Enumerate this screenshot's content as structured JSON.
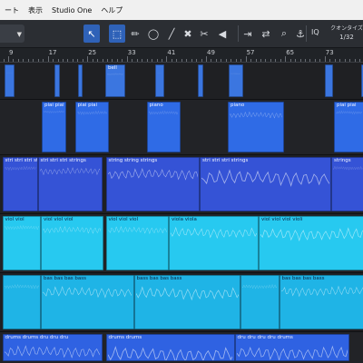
{
  "menu": {
    "items": [
      "ート",
      "表示",
      "Studio One",
      "ヘルプ"
    ]
  },
  "toolbar": {
    "tools": [
      {
        "name": "arrow-tool-icon",
        "glyph": "↖",
        "active": true
      },
      {
        "name": "range-tool-icon",
        "glyph": "⬚",
        "active": true
      },
      {
        "name": "pencil-tool-icon",
        "glyph": "✏",
        "active": false
      },
      {
        "name": "eraser-tool-icon",
        "glyph": "◯",
        "active": false
      },
      {
        "name": "paint-tool-icon",
        "glyph": "╱",
        "active": false
      },
      {
        "name": "mute-tool-icon",
        "glyph": "✖",
        "active": false
      },
      {
        "name": "split-tool-icon",
        "glyph": "✂",
        "active": false
      },
      {
        "name": "listen-tool-icon",
        "glyph": "◀",
        "active": false
      },
      {
        "name": "skip-forward-icon",
        "glyph": "⇥",
        "active": false
      },
      {
        "name": "shuffle-icon",
        "glyph": "⇄",
        "active": false
      },
      {
        "name": "zoom-tool-icon",
        "glyph": "⌕",
        "active": false
      },
      {
        "name": "snap-icon",
        "glyph": "⚓",
        "active": false
      }
    ],
    "iq_label": "IQ",
    "quantize_label": "クオンタイズ",
    "quantize_value": "1/32"
  },
  "ruler": {
    "bars": [
      {
        "label": "9",
        "bar": 9
      },
      {
        "label": "17",
        "bar": 17
      },
      {
        "label": "25",
        "bar": 25
      },
      {
        "label": "33",
        "bar": 33
      },
      {
        "label": "41",
        "bar": 41
      },
      {
        "label": "49",
        "bar": 49
      },
      {
        "label": "57",
        "bar": 57
      },
      {
        "label": "65",
        "bar": 65
      },
      {
        "label": "73",
        "bar": 73
      }
    ]
  },
  "colors": {
    "bell": "#3b76e0",
    "piano": "#2f6be6",
    "strings": "#3553d6",
    "violin": "#27c9f0",
    "bass": "#1fb4e6",
    "drums": "#2f62e2",
    "playhead": "#2f7dff"
  },
  "lanes": [
    {
      "name": "bell",
      "color": "bell",
      "clips": [
        {
          "s": 0.97,
          "e": 3.17,
          "label": ""
        },
        {
          "s": 11.9,
          "e": 13.2,
          "label": ""
        },
        {
          "s": 17.2,
          "e": 18.1,
          "label": ""
        },
        {
          "s": 23.2,
          "e": 27.5,
          "label": "bell"
        },
        {
          "s": 34.1,
          "e": 36.1,
          "label": ""
        },
        {
          "s": 43.5,
          "e": 44.8,
          "label": ""
        },
        {
          "s": 50.3,
          "e": 53.5,
          "label": ""
        },
        {
          "s": 71.6,
          "e": 73.3,
          "label": ""
        },
        {
          "s": 79.5,
          "e": 80.3,
          "label": ""
        }
      ]
    },
    {
      "name": "piano",
      "color": "piano",
      "clips": [
        {
          "s": 9.2,
          "e": 14.5,
          "label": "piai piai piai piai"
        },
        {
          "s": 16.5,
          "e": 24.0,
          "label": "piai piai"
        },
        {
          "s": 32.3,
          "e": 39.7,
          "label": "piano"
        },
        {
          "s": 50.2,
          "e": 62.5,
          "label": "piano"
        },
        {
          "s": 73.6,
          "e": 80.3,
          "label": "piai piai"
        }
      ]
    },
    {
      "name": "strings",
      "color": "strings",
      "clips": [
        {
          "s": 0.5,
          "e": 8.3,
          "label": "stri stri stri strings"
        },
        {
          "s": 8.3,
          "e": 22.5,
          "label": "stri stri stri strings"
        },
        {
          "s": 23.3,
          "e": 44.0,
          "label": "string string strings"
        },
        {
          "s": 44.0,
          "e": 73.0,
          "label": "stri stri stri strings"
        },
        {
          "s": 73.0,
          "e": 80.3,
          "label": "strings"
        }
      ]
    },
    {
      "name": "violin",
      "color": "violin",
      "clips": [
        {
          "s": 0.5,
          "e": 9.0,
          "label": "viol viol"
        },
        {
          "s": 9.0,
          "e": 22.7,
          "label": "viol viol viol"
        },
        {
          "s": 23.3,
          "e": 37.2,
          "label": "viol viol viol"
        },
        {
          "s": 37.2,
          "e": 57.0,
          "label": "viola viola"
        },
        {
          "s": 57.0,
          "e": 80.3,
          "label": "viol viol viol violi"
        }
      ]
    },
    {
      "name": "bass",
      "color": "bass",
      "clips": [
        {
          "s": 0.5,
          "e": 9.0,
          "label": ""
        },
        {
          "s": 9.0,
          "e": 29.5,
          "label": "bas bas bas bass"
        },
        {
          "s": 29.5,
          "e": 53.0,
          "label": "bass bas bas bass"
        },
        {
          "s": 53.0,
          "e": 61.5,
          "label": ""
        },
        {
          "s": 61.5,
          "e": 80.3,
          "label": "bas bas bas bass"
        }
      ]
    },
    {
      "name": "drums",
      "color": "drums",
      "clips": [
        {
          "s": 0.5,
          "e": 22.5,
          "label": "drums drums dru dru dru"
        },
        {
          "s": 23.3,
          "e": 51.7,
          "label": "drums drums"
        },
        {
          "s": 51.7,
          "e": 77.0,
          "label": "dru dru dru dru drums"
        },
        {
          "s": 81.0,
          "e": 92.0,
          "label": "drums drums"
        }
      ]
    }
  ]
}
